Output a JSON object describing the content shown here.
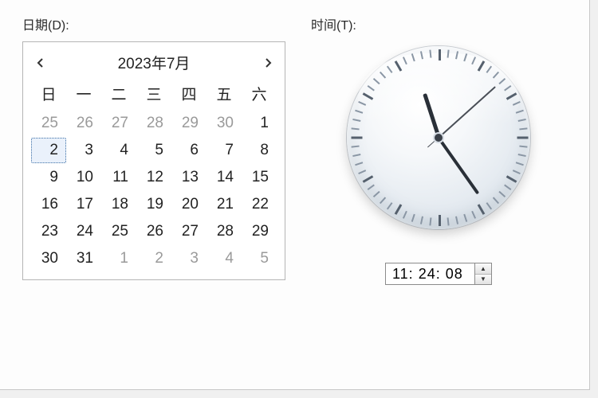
{
  "labels": {
    "date": "日期(D):",
    "time": "时间(T):"
  },
  "calendar": {
    "title": "2023年7月",
    "headers": [
      "日",
      "一",
      "二",
      "三",
      "四",
      "五",
      "六"
    ],
    "weeks": [
      [
        {
          "d": 25,
          "other": true
        },
        {
          "d": 26,
          "other": true
        },
        {
          "d": 27,
          "other": true
        },
        {
          "d": 28,
          "other": true
        },
        {
          "d": 29,
          "other": true
        },
        {
          "d": 30,
          "other": true
        },
        {
          "d": 1
        }
      ],
      [
        {
          "d": 2,
          "selected": true
        },
        {
          "d": 3
        },
        {
          "d": 4
        },
        {
          "d": 5
        },
        {
          "d": 6
        },
        {
          "d": 7
        },
        {
          "d": 8
        }
      ],
      [
        {
          "d": 9
        },
        {
          "d": 10
        },
        {
          "d": 11
        },
        {
          "d": 12
        },
        {
          "d": 13
        },
        {
          "d": 14
        },
        {
          "d": 15
        }
      ],
      [
        {
          "d": 16
        },
        {
          "d": 17
        },
        {
          "d": 18
        },
        {
          "d": 19
        },
        {
          "d": 20
        },
        {
          "d": 21
        },
        {
          "d": 22
        }
      ],
      [
        {
          "d": 23
        },
        {
          "d": 24
        },
        {
          "d": 25
        },
        {
          "d": 26
        },
        {
          "d": 27
        },
        {
          "d": 28
        },
        {
          "d": 29
        }
      ],
      [
        {
          "d": 30
        },
        {
          "d": 31
        },
        {
          "d": 1,
          "other": true
        },
        {
          "d": 2,
          "other": true
        },
        {
          "d": 3,
          "other": true
        },
        {
          "d": 4,
          "other": true
        },
        {
          "d": 5,
          "other": true
        }
      ]
    ]
  },
  "clock": {
    "hours": 11,
    "minutes": 24,
    "seconds": 8,
    "display": "11: 24: 08"
  }
}
